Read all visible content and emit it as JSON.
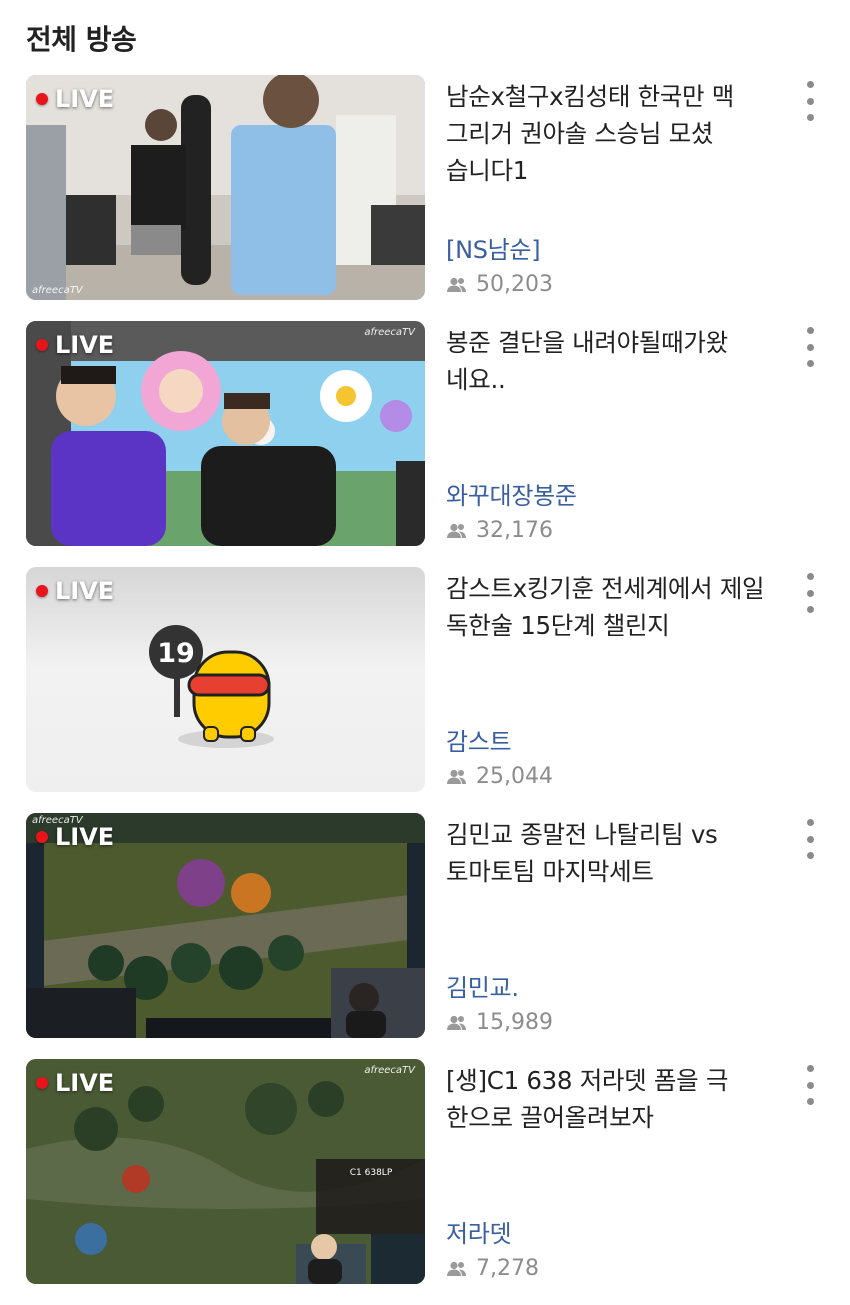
{
  "section": {
    "title": "전체 방송"
  },
  "live_label": "LIVE",
  "colors": {
    "live_dot": "#e8141b",
    "streamer_link": "#3a5fa0",
    "meta_gray": "#8c8c8c"
  },
  "icons": {
    "viewers": "people-icon",
    "more": "more-vert-icon"
  },
  "streams": [
    {
      "title": "남순x철구x킴성태 한국만 맥 그리거 권아솔 스승님 모셨 습니다1",
      "streamer": "[NS남순]",
      "viewers": "50,203",
      "thumb_watermark": "afreecaTV"
    },
    {
      "title": "봉준 결단을 내려야될때가왔 네요..",
      "streamer": "와꾸대장봉준",
      "viewers": "32,176",
      "thumb_watermark": "afreecaTV"
    },
    {
      "title": "감스트x킹기훈 전세계에서 제일 독한술 15단계 챌린지",
      "streamer": "감스트",
      "viewers": "25,044",
      "thumb_badge": "19"
    },
    {
      "title": "김민교 종말전 나탈리팀 vs 토마토팀 마지막세트",
      "streamer": "김민교.",
      "viewers": "15,989",
      "thumb_watermark": "afreecaTV"
    },
    {
      "title": "[생]C1 638 저라뎃 폼을 극 한으로 끌어올려보자",
      "streamer": "저라뎃",
      "viewers": "7,278",
      "thumb_watermark": "afreecaTV",
      "thumb_overlay": "C1 638LP"
    }
  ]
}
